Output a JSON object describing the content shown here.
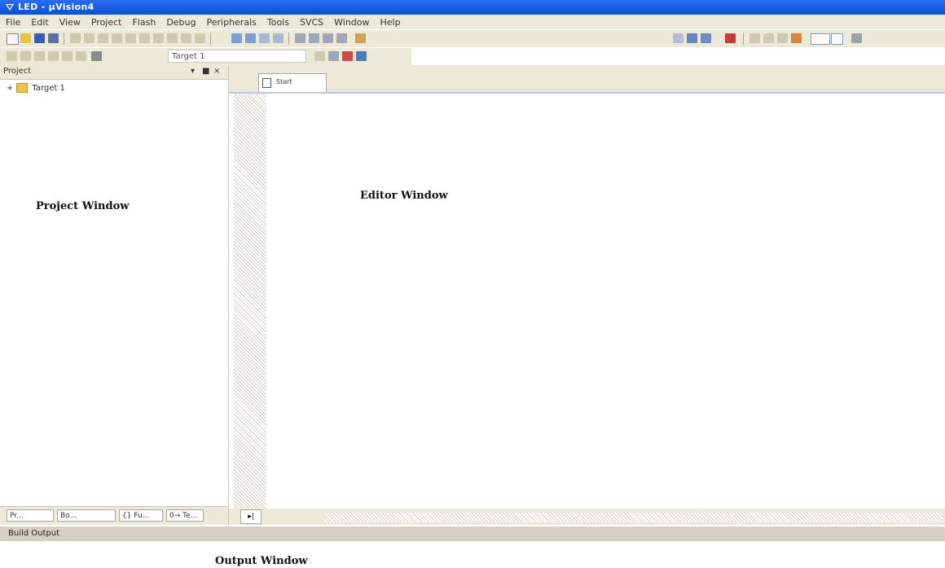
{
  "window": {
    "title": "LED - µVision4"
  },
  "menu": [
    "File",
    "Edit",
    "View",
    "Project",
    "Flash",
    "Debug",
    "Peripherals",
    "Tools",
    "SVCS",
    "Window",
    "Help"
  ],
  "toolbar2": {
    "target_value": "Target 1"
  },
  "project_panel": {
    "title": "Project",
    "controls": [
      "▾",
      "■",
      "×"
    ],
    "tree_expander": "+",
    "tree_root": "Target 1",
    "window_label": "Project Window",
    "tabs": [
      "Pr...",
      "Bo...",
      "{} Fu...",
      "0→ Te..."
    ]
  },
  "editor": {
    "tab_title": "Start",
    "window_label": "Editor Window",
    "scroll_tab": "▸|"
  },
  "build_output": {
    "title": "Build Output",
    "window_label": "Output Window"
  },
  "colors": {
    "titlebar": "#0a4fd6",
    "chrome": "#ece9d8",
    "editor_bg": "#ffffff"
  }
}
